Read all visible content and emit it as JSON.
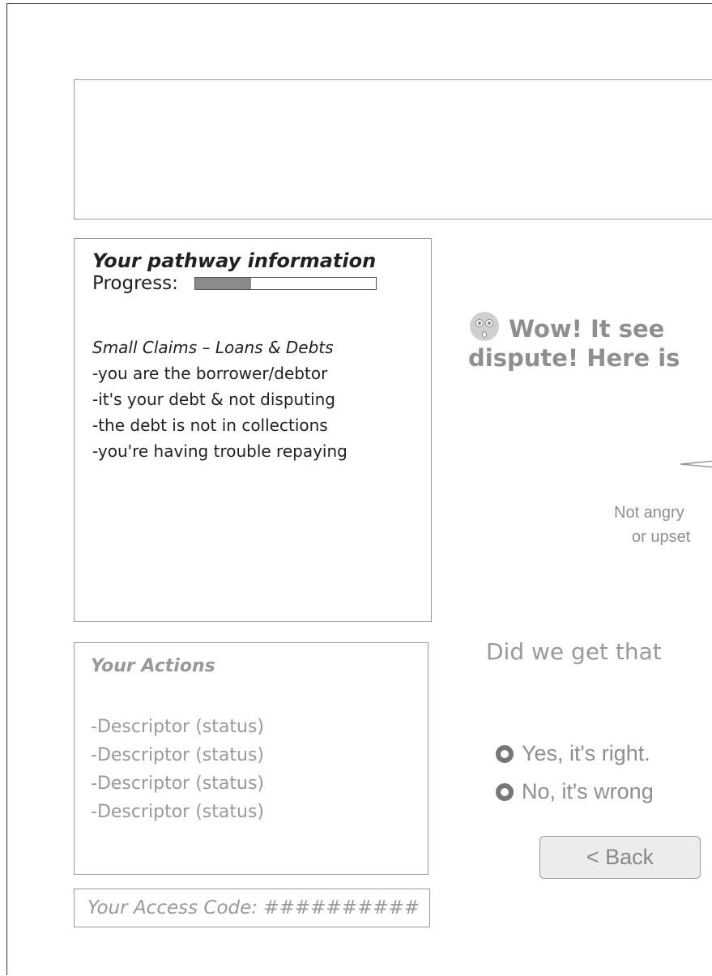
{
  "pathway": {
    "title": "Your pathway information",
    "progress_label": "Progress:",
    "progress_fraction": 0.31,
    "category": "Small Claims – Loans & Debts",
    "lines": [
      "-you are the borrower/debtor",
      "-it's your debt & not disputing",
      "-the debt is not in collections",
      "-you're having trouble repaying"
    ]
  },
  "actions": {
    "title": "Your Actions",
    "items": [
      "-Descriptor (status)",
      "-Descriptor (status)",
      "-Descriptor (status)",
      "-Descriptor (status)"
    ]
  },
  "access_code": "Your Access Code: ##########",
  "headline": {
    "line1": "Wow! It see",
    "line2": "dispute! Here is",
    "emoji_icon": "surprised-face-icon"
  },
  "scale": {
    "label_line1": "Not angry",
    "label_line2": "or upset"
  },
  "question": "Did we get that",
  "options": [
    {
      "label": "Yes, it's right."
    },
    {
      "label": "No, it's wrong"
    }
  ],
  "back_button": "< Back",
  "colors": {
    "muted_text": "#999999",
    "progress_fill": "#8a8a8a",
    "button_bg": "#ececec"
  }
}
